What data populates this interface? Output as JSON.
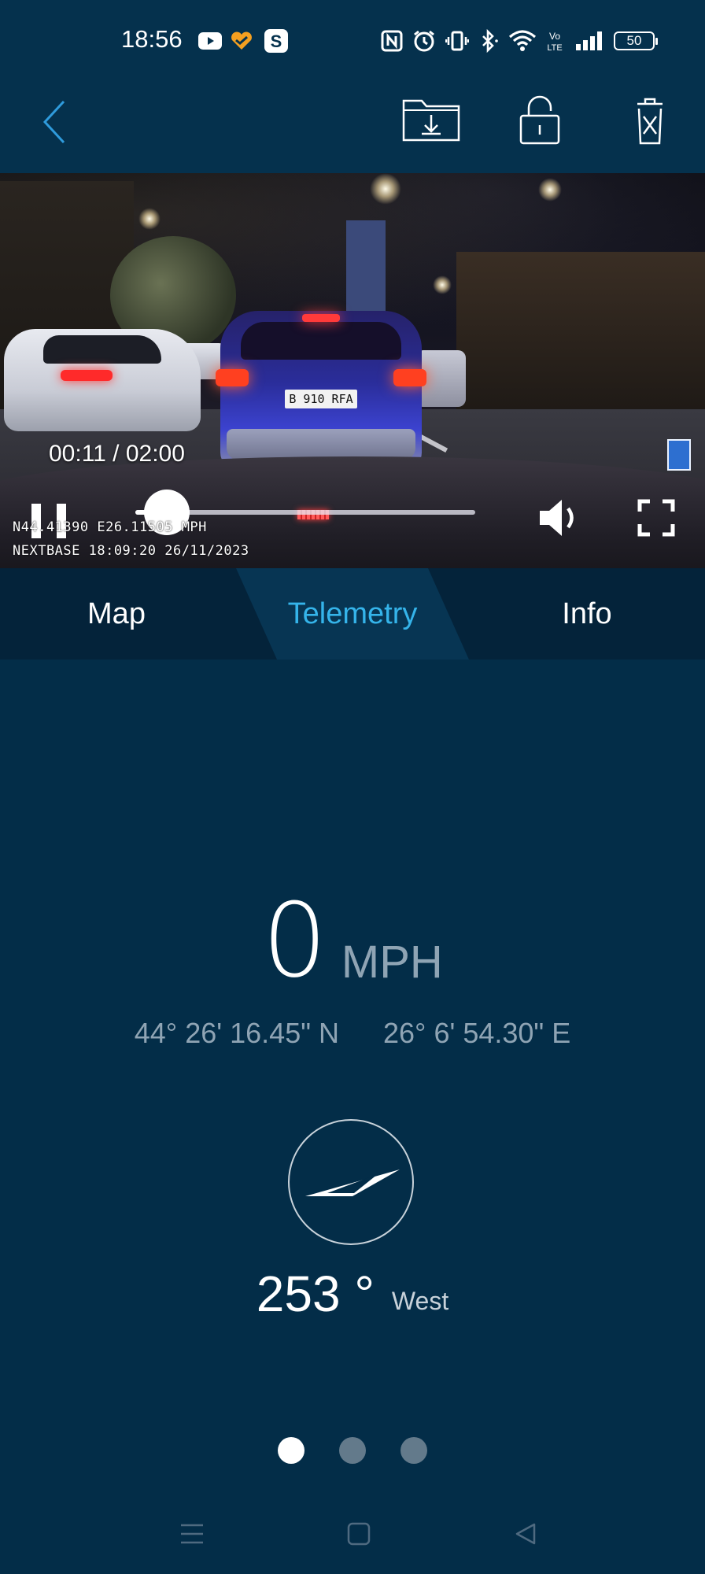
{
  "status_bar": {
    "time": "18:56",
    "battery": "50",
    "icons": [
      "youtube-icon",
      "heart-app-icon",
      "s-app-icon",
      "nfc-icon",
      "alarm-icon",
      "vibrate-icon",
      "bluetooth-icon",
      "wifi-icon",
      "volte-icon",
      "signal-icon",
      "battery-icon"
    ]
  },
  "header": {
    "icons": [
      "back-icon",
      "download-folder-icon",
      "lock-icon",
      "trash-icon"
    ]
  },
  "video": {
    "time_label": "00:11 / 02:00",
    "progress": 0.092,
    "plate": "B 910 RFA",
    "osd_line1": "N44.41390 E26.11505 MPH",
    "osd_line2": "NEXTBASE 18:09:20 26/11/2023",
    "icons": [
      "pause-icon",
      "volume-icon",
      "fullscreen-icon"
    ]
  },
  "tabs": [
    {
      "label": "Map",
      "active": false
    },
    {
      "label": "Telemetry",
      "active": true
    },
    {
      "label": "Info",
      "active": false
    }
  ],
  "telemetry": {
    "speed": "0",
    "speed_unit": "MPH",
    "latitude": "44° 26' 16.45\" N",
    "longitude": "26° 6' 54.30\" E",
    "heading": "253 °",
    "heading_direction": "West"
  },
  "pager": {
    "count": 3,
    "active_index": 0
  },
  "colors": {
    "background": "#032d48",
    "tab_bar": "#04233a",
    "tab_active_bg": "#073553",
    "accent": "#35b4ea",
    "muted_text": "#8fa4b4"
  },
  "navbar": {
    "icons": [
      "menu-icon",
      "home-icon",
      "back-triangle-icon"
    ]
  }
}
